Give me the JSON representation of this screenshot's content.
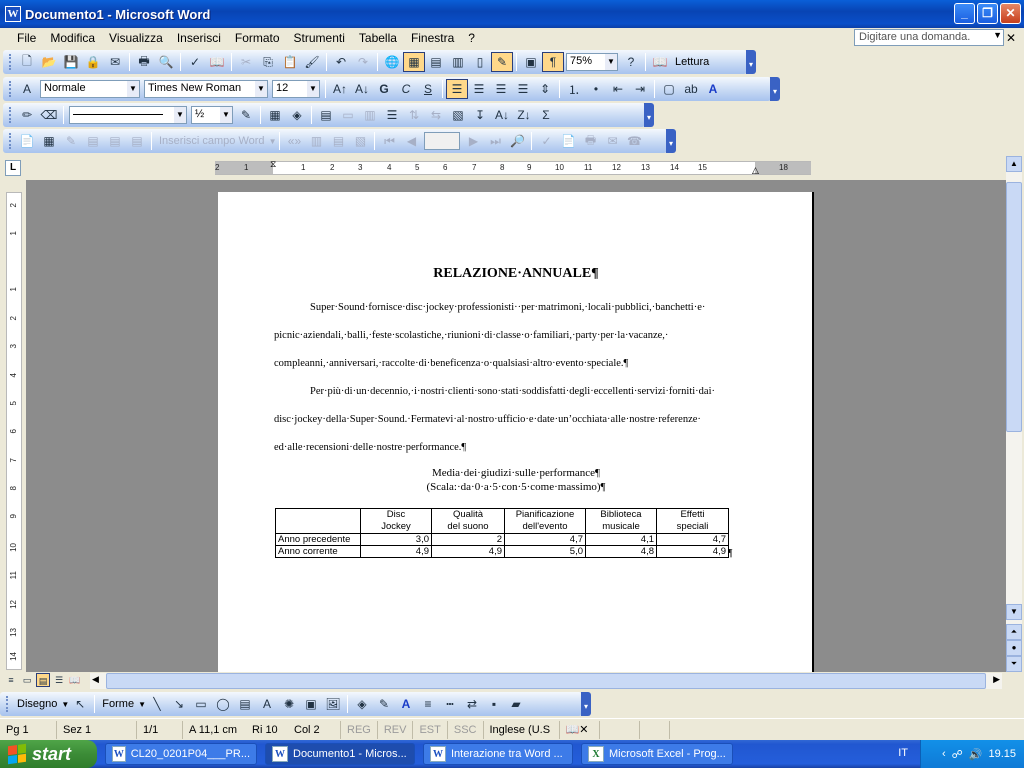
{
  "window": {
    "title": "Documento1 - Microsoft Word"
  },
  "menu": {
    "items": [
      "File",
      "Modifica",
      "Visualizza",
      "Inserisci",
      "Formato",
      "Strumenti",
      "Tabella",
      "Finestra",
      "?"
    ],
    "help_placeholder": "Digitare una domanda."
  },
  "toolbar_standard": {
    "zoom": "75%",
    "reading": "Lettura"
  },
  "toolbar_formatting": {
    "style": "Normale",
    "font": "Times New Roman",
    "size": "12"
  },
  "toolbar_drawlines": {
    "line_weight": "½"
  },
  "toolbar_mailmerge": {
    "insert_field": "Inserisci campo Word"
  },
  "ruler": {
    "h_ticks": [
      "2",
      "1",
      "1",
      "2",
      "3",
      "4",
      "5",
      "6",
      "7",
      "8",
      "9",
      "10",
      "11",
      "12",
      "13",
      "14",
      "15",
      "16",
      "18"
    ],
    "v_ticks": [
      "2",
      "1",
      "1",
      "2",
      "3",
      "4",
      "5",
      "6",
      "7",
      "8",
      "9",
      "10",
      "11",
      "12",
      "13",
      "14"
    ]
  },
  "document": {
    "title": "RELAZIONE·ANNUALE¶",
    "p1": [
      "Super·Sound·fornisce·disc·jockey·professionisti··per·matrimoni,·locali·pubblici,·banchetti·e·",
      "picnic·aziendali,·balli,·feste·scolastiche,·riunioni·di·classe·o·familiari,·party·per·la·vacanze,·",
      "compleanni,·anniversari,·raccolte·di·beneficenza·o·qualsiasi·altro·evento·speciale.¶"
    ],
    "p2": [
      "Per·più·di·un·decennio,·i·nostri·clienti·sono·stati·soddisfatti·degli·eccellenti·servizi·forniti·dai·",
      "disc·jockey·della·Super·Sound.·Fermatevi·al·nostro·ufficio·e·date·un’occhiata·alle·nostre·referenze·",
      "ed·alle·recensioni·delle·nostre·performance.¶"
    ],
    "caption1": "Media·dei·giudizi·sulle·performance¶",
    "caption2": "(Scala:·da·0·a·5·con·5·come·massimo)¶",
    "table": {
      "headers": [
        [
          "Disc",
          "Jockey"
        ],
        [
          "Qualità",
          "del suono"
        ],
        [
          "Pianificazione",
          "dell'evento"
        ],
        [
          "Biblioteca",
          "musicale"
        ],
        [
          "Effetti",
          "speciali"
        ]
      ],
      "rows": [
        {
          "label": "Anno precedente",
          "values": [
            "3,0",
            "2",
            "4,7",
            "4,1",
            "4,7"
          ]
        },
        {
          "label": "Anno corrente",
          "values": [
            "4,9",
            "4,9",
            "5,0",
            "4,8",
            "4,9"
          ]
        }
      ],
      "end_mark": "¶"
    }
  },
  "drawbar": {
    "draw": "Disegno",
    "shapes": "Forme"
  },
  "status": {
    "page": "Pg 1",
    "section": "Sez 1",
    "pages": "1/1",
    "at": "A  11,1 cm",
    "line": "Ri  10",
    "col": "Col  2",
    "rec": "REG",
    "rev": "REV",
    "ext": "EST",
    "ovr": "SSC",
    "lang": "Inglese (U.S"
  },
  "taskbar": {
    "start": "start",
    "tasks": [
      "CL20_0201P04___PR...",
      "Documento1 - Micros...",
      "Interazione tra Word ...",
      "Microsoft Excel - Prog..."
    ],
    "lang": "IT",
    "clock": "19.15"
  }
}
